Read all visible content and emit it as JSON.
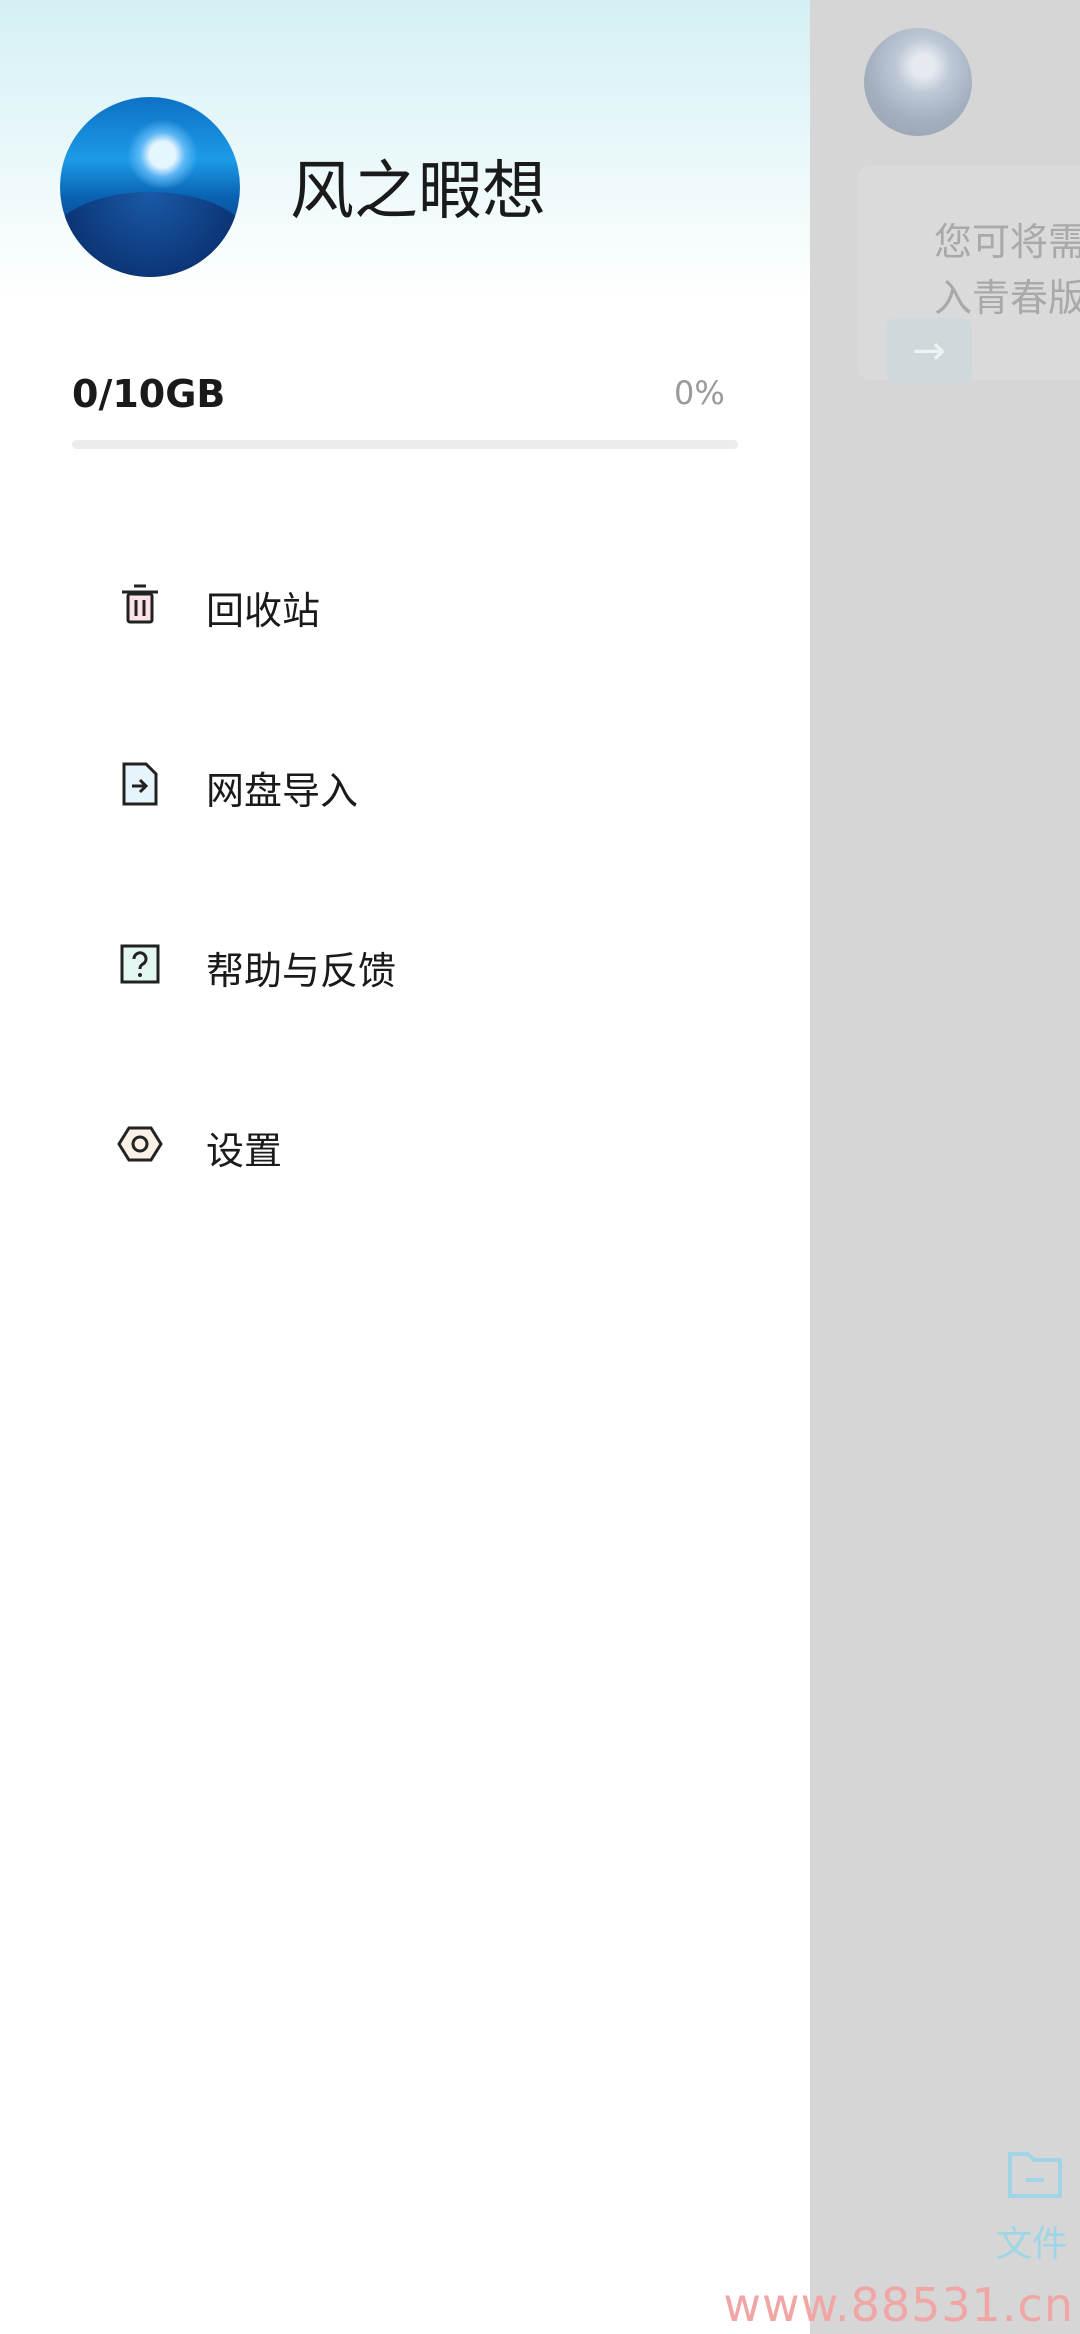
{
  "drawer": {
    "username": "风之暇想",
    "storage": {
      "used_label": "0/10GB",
      "percent_label": "0%",
      "fill_fraction": 0
    },
    "menu": [
      {
        "label": "回收站",
        "icon": "trash-icon"
      },
      {
        "label": "网盘导入",
        "icon": "import-file-icon"
      },
      {
        "label": "帮助与反馈",
        "icon": "help-icon"
      },
      {
        "label": "设置",
        "icon": "settings-icon"
      }
    ]
  },
  "background_app": {
    "hint_text": "您可将需\n入青春版",
    "bottom_tab_label": "文件"
  },
  "watermark": "www.88531.cn",
  "colors": {
    "accent": "#38b6d8",
    "overlay": "#d6d6d6"
  }
}
